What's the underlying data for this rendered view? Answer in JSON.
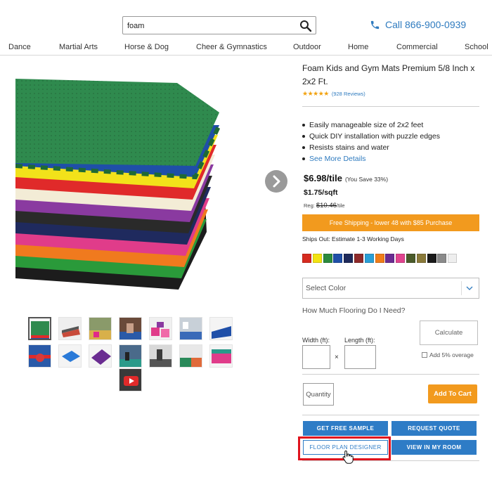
{
  "header": {
    "search": {
      "value": "foam",
      "placeholder": ""
    },
    "phone": "Call 866-900-0939"
  },
  "nav": [
    "Dance",
    "Martial Arts",
    "Horse & Dog",
    "Cheer & Gymnastics",
    "Outdoor",
    "Home",
    "Commercial",
    "School"
  ],
  "product": {
    "title": "Foam Kids and Gym Mats Premium 5/8 Inch x 2x2 Ft.",
    "stars": "★★★★★",
    "reviews": "(928 Reviews)",
    "features": [
      "Easily manageable size of 2x2 feet",
      "Quick DIY installation with puzzle edges",
      "Resists stains and water"
    ],
    "see_more": "See More Details",
    "price": "$6.98/tile",
    "you_save": "(You Save 33%)",
    "price_sqft": "$1.75/sqft",
    "reg_label": "Reg:",
    "reg_price": "$10.46",
    "reg_unit": "/tile",
    "shipping": "Free Shipping - lower 48 with $85 Purchase",
    "ships_out": "Ships Out: Estimate 1-3 Working Days",
    "swatch_colors": [
      "#d62b1f",
      "#f2e312",
      "#2b8a3e",
      "#1f4fa8",
      "#1e2a5a",
      "#8e2a2a",
      "#2a9fd6",
      "#f07d1a",
      "#6a2c91",
      "#e0448f",
      "#4a5a2a",
      "#8a7a3a",
      "#1a1a1a",
      "#8a8a8a",
      "#eeeeee"
    ]
  },
  "configurator": {
    "select_color": "Select Color",
    "how_much": "How Much Flooring Do I Need?",
    "width_label": "Width (ft):",
    "length_label": "Length (ft):",
    "times": "×",
    "calculate": "Calculate",
    "overage": "Add 5% overage",
    "quantity": "Quantity",
    "add_to_cart": "Add To Cart"
  },
  "actions": {
    "free_sample": "GET FREE SAMPLE",
    "request_quote": "REQUEST QUOTE",
    "floor_plan": "FLOOR PLAN DESIGNER",
    "view_room": "VIEW IN MY ROOM"
  },
  "colors": {
    "accent_blue": "#2e7cc6",
    "accent_orange": "#f29a1e",
    "highlight_red": "#e0141e"
  }
}
